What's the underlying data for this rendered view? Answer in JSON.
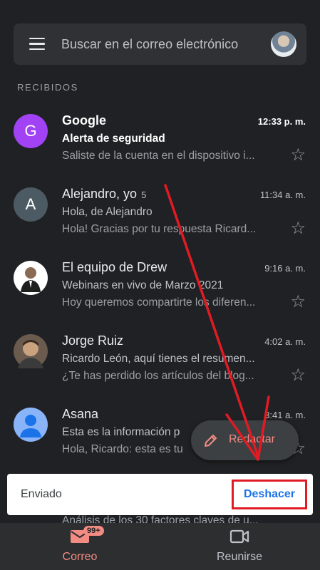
{
  "search": {
    "placeholder": "Buscar en el correo electrónico"
  },
  "section": {
    "label": "RECIBIDOS"
  },
  "emails": [
    {
      "sender": "Google",
      "count": "",
      "time": "12:33 p. m.",
      "subject": "Alerta de seguridad",
      "snippet": "Saliste de la cuenta en el dispositivo i...",
      "unread": true,
      "avatar_letter": "G",
      "avatar_color": "#a142f4"
    },
    {
      "sender": "Alejandro, yo",
      "count": "5",
      "time": "11:34 a. m.",
      "subject": "Hola, de Alejandro",
      "snippet": "Hola! Gracias por tu respuesta Ricard...",
      "unread": false,
      "avatar_letter": "A",
      "avatar_color": "#4b5a63"
    },
    {
      "sender": "El equipo de Drew",
      "count": "",
      "time": "9:16 a. m.",
      "subject": "Webinars en vivo de Marzo 2021",
      "snippet": "Hoy queremos compartirte los diferen...",
      "unread": false,
      "avatar_letter": "",
      "avatar_color": "#ffffff"
    },
    {
      "sender": "Jorge Ruiz",
      "count": "",
      "time": "4:02 a. m.",
      "subject": "Ricardo León, aquí tienes el resumen...",
      "snippet": "¿Te has perdido los artículos del blog...",
      "unread": false,
      "avatar_letter": "",
      "avatar_color": "#6b5a4e"
    },
    {
      "sender": "Asana",
      "count": "",
      "time": "3:41 a. m.",
      "subject": "Esta es la información p",
      "snippet": "Hola, Ricardo: esta es tu",
      "unread": false,
      "avatar_letter": "",
      "avatar_color": "#8ab4f8"
    }
  ],
  "partial_snippet": "Análisis de los 30 factores claves de u...",
  "fab": {
    "label": "Redactar",
    "icon": "pencil-icon"
  },
  "snackbar": {
    "text": "Enviado",
    "action": "Deshacer"
  },
  "bottom_nav": {
    "mail": {
      "label": "Correo",
      "badge": "99+",
      "icon": "mail-icon"
    },
    "meet": {
      "label": "Reunirse",
      "icon": "video-icon"
    }
  },
  "colors": {
    "accent": "#f28b82",
    "annotation_red": "#e01b24",
    "link_blue": "#1a73e8"
  }
}
